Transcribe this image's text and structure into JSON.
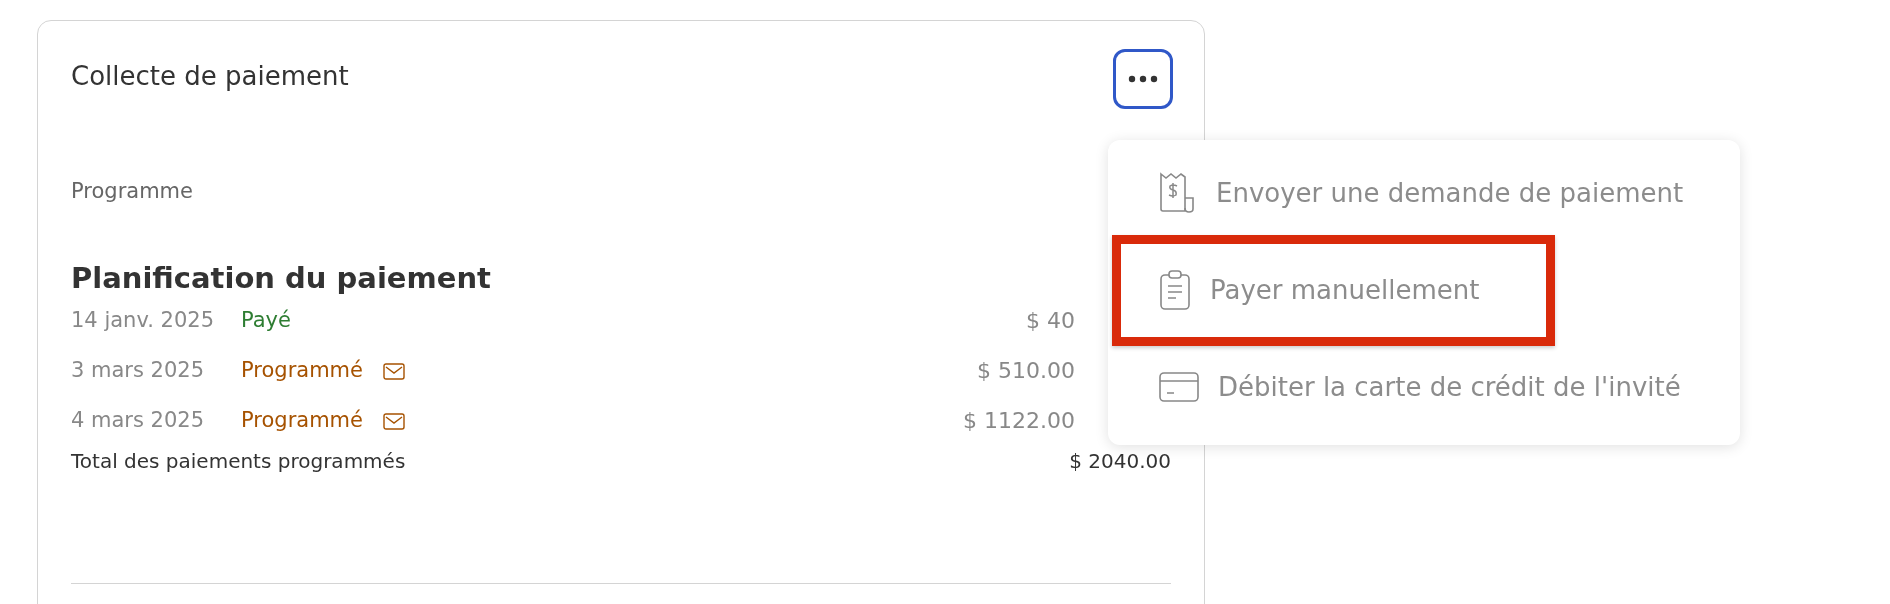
{
  "card": {
    "title": "Collecte de paiement",
    "section_label": "Programme",
    "heading": "Planification du paiement",
    "payments": [
      {
        "date": "14 janv. 2025",
        "status": "Payé",
        "kind": "paid",
        "reminder": false,
        "amount": "$ 40"
      },
      {
        "date": "3 mars 2025",
        "status": "Programmé",
        "kind": "scheduled",
        "reminder": true,
        "amount": "$ 510.00"
      },
      {
        "date": "4 mars 2025",
        "status": "Programmé",
        "kind": "scheduled",
        "reminder": true,
        "amount": "$ 1122.00"
      }
    ],
    "total": {
      "label": "Total des paiements programmés",
      "amount": "$ 2040.00"
    }
  },
  "menu": {
    "expanded": true,
    "items": [
      {
        "label": "Envoyer une demande de paiement",
        "kind": "receipt",
        "highlighted": false
      },
      {
        "label": "Payer manuellement",
        "kind": "clipboard",
        "highlighted": true
      },
      {
        "label": "Débiter la carte de crédit de l'invité",
        "kind": "card",
        "highlighted": false
      }
    ]
  }
}
